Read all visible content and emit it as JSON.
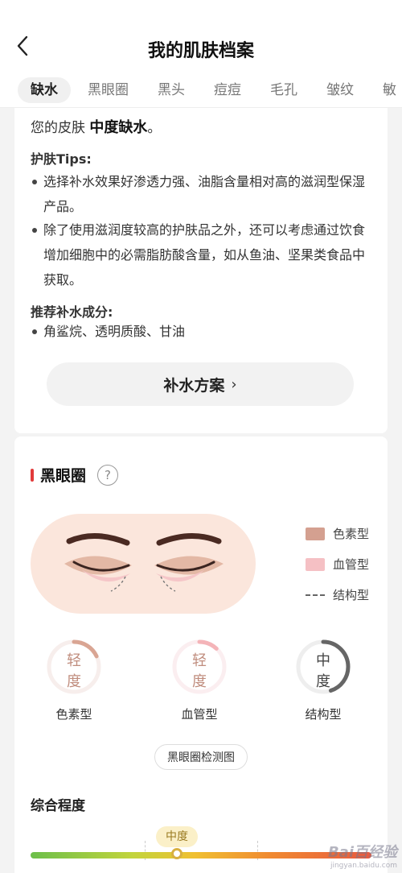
{
  "header": {
    "title": "我的肌肤档案"
  },
  "tabs": [
    {
      "label": "缺水",
      "active": true
    },
    {
      "label": "黑眼圈"
    },
    {
      "label": "黑头"
    },
    {
      "label": "痘痘"
    },
    {
      "label": "毛孔"
    },
    {
      "label": "皱纹"
    },
    {
      "label": "敏"
    }
  ],
  "hydration": {
    "summary_prefix": "您的皮肤 ",
    "summary_level": "中度缺水",
    "summary_suffix": "。",
    "tips_heading": "护肤Tips:",
    "tips": [
      "选择补水效果好渗透力强、油脂含量相对高的滋润型保湿产品。",
      "除了使用滋润度较高的护肤品之外，还可以考虑通过饮食增加细胞中的必需脂肪酸含量，如从鱼油、坚果类食品中获取。"
    ],
    "ingredients_heading": "推荐补水成分:",
    "ingredients": "角鲨烷、透明质酸、甘油",
    "plan_button": "补水方案"
  },
  "dark_circles": {
    "title": "黑眼圈",
    "help_icon": "?",
    "legend": [
      {
        "label": "色素型",
        "color": "#d4a090",
        "style": "fill"
      },
      {
        "label": "血管型",
        "color": "#f5c0c4",
        "style": "fill"
      },
      {
        "label": "结构型",
        "color": "#666666",
        "style": "dashed"
      }
    ],
    "gauges": [
      {
        "label": "色素型",
        "level_line1": "轻",
        "level_line2": "度",
        "fraction": 0.18,
        "color": "#d9a593",
        "text_color": "#c08d7e"
      },
      {
        "label": "血管型",
        "level_line1": "轻",
        "level_line2": "度",
        "fraction": 0.12,
        "color": "#f4b4b8",
        "text_color": "#c08d7e"
      },
      {
        "label": "结构型",
        "level_line1": "中",
        "level_line2": "度",
        "fraction": 0.45,
        "color": "#666666",
        "text_color": "#444444"
      }
    ],
    "detect_button": "黑眼圈检测图"
  },
  "overall": {
    "heading": "综合程度",
    "level": "中度",
    "fraction": 0.43
  },
  "watermark": {
    "brand": "Bai百经验",
    "url": "jingyan.baidu.com"
  },
  "colors": {
    "accent_red": "#e23b3b",
    "level_badge_bg": "#fbf0c8",
    "level_badge_text": "#9a7a20"
  }
}
